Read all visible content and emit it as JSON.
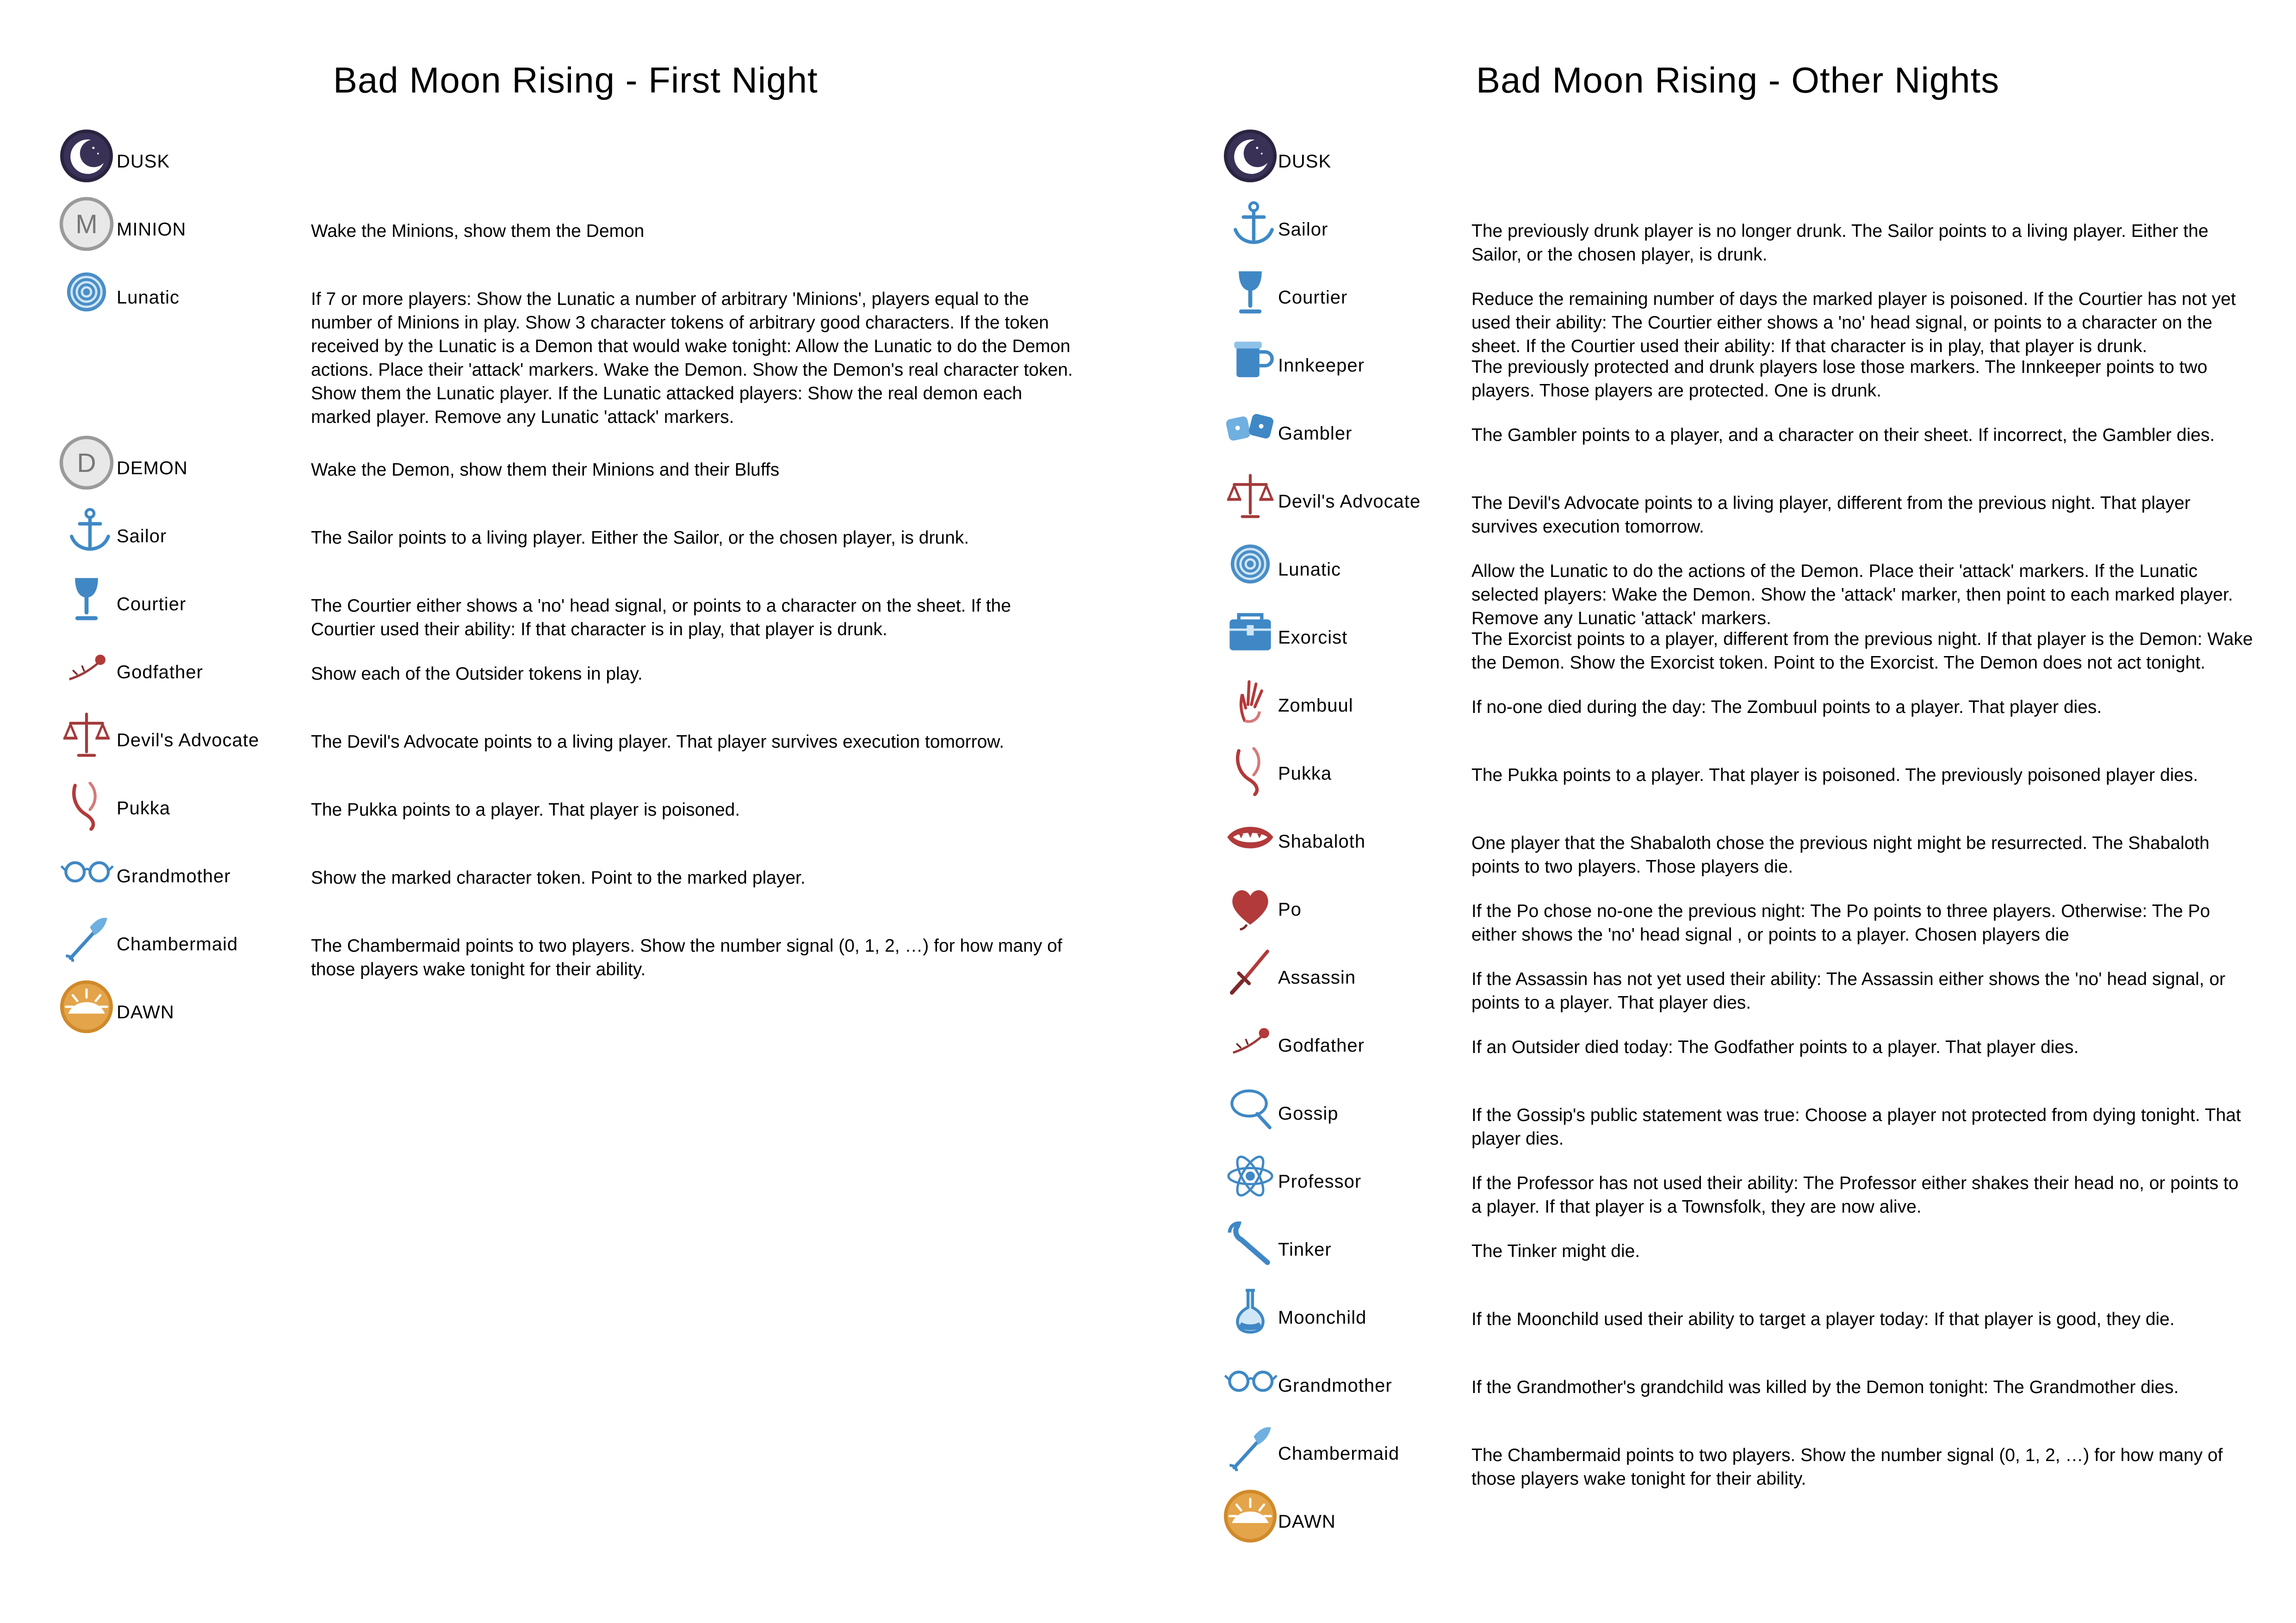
{
  "first_night": {
    "title": "Bad Moon Rising - First Night",
    "entries": [
      {
        "icon": "moon-icon",
        "name": "DUSK",
        "text": ""
      },
      {
        "icon": "minion-token-icon",
        "name": "MINION",
        "text": "Wake the Minions, show them the Demon"
      },
      {
        "icon": "spiral-icon",
        "name": "Lunatic",
        "text": "If 7 or more players: Show the Lunatic a number of arbitrary 'Minions', players equal to the number of Minions in play. Show 3 character tokens of arbitrary good characters. If the token received by the Lunatic is a Demon that would wake tonight: Allow the Lunatic to do the Demon actions. Place their 'attack' markers. Wake the Demon. Show the Demon's real character token. Show them the Lunatic player. If the Lunatic attacked players: Show the real demon each marked player. Remove any Lunatic 'attack' markers."
      },
      {
        "icon": "demon-token-icon",
        "name": "DEMON",
        "text": "Wake the Demon, show them their Minions and their Bluffs"
      },
      {
        "icon": "anchor-icon",
        "name": "Sailor",
        "text": "The Sailor points to a living player. Either the Sailor, or the chosen player, is drunk."
      },
      {
        "icon": "goblet-icon",
        "name": "Courtier",
        "text": "The Courtier either shows a 'no' head signal, or points to a character on the sheet. If the Courtier used their ability: If that character is in play, that player is drunk."
      },
      {
        "icon": "rose-icon",
        "name": "Godfather",
        "text": "Show each of the Outsider tokens in play."
      },
      {
        "icon": "scales-icon",
        "name": "Devil's Advocate",
        "text": "The Devil's Advocate points to a living player. That player survives execution tomorrow."
      },
      {
        "icon": "bone-icon",
        "name": "Pukka",
        "text": "The Pukka points to a player. That player is poisoned."
      },
      {
        "icon": "glasses-icon",
        "name": "Grandmother",
        "text": "Show the marked character token. Point to the marked player."
      },
      {
        "icon": "feather-duster-icon",
        "name": "Chambermaid",
        "text": "The Chambermaid points to two players. Show the number signal (0, 1, 2, …) for how many of those players wake tonight for their ability."
      },
      {
        "icon": "sun-icon",
        "name": "DAWN",
        "text": ""
      }
    ]
  },
  "other_nights": {
    "title": "Bad Moon Rising - Other Nights",
    "entries": [
      {
        "icon": "moon-icon",
        "name": "DUSK",
        "text": ""
      },
      {
        "icon": "anchor-icon",
        "name": "Sailor",
        "text": "The previously drunk player is no longer drunk. The Sailor points to a living player. Either the Sailor, or the chosen player, is drunk."
      },
      {
        "icon": "goblet-icon",
        "name": "Courtier",
        "text": "Reduce the remaining number of days the marked player is poisoned. If the Courtier has not yet used their ability: The Courtier either shows a 'no' head signal, or points to a character on the sheet. If the Courtier used their ability: If that character is in play, that player is drunk."
      },
      {
        "icon": "tankard-icon",
        "name": "Innkeeper",
        "text": "The previously protected and drunk players lose those markers. The Innkeeper points to two players. Those players are protected. One is drunk."
      },
      {
        "icon": "dice-icon",
        "name": "Gambler",
        "text": "The Gambler points to a player, and a character on their sheet. If incorrect, the Gambler dies."
      },
      {
        "icon": "scales-icon",
        "name": "Devil's Advocate",
        "text": "The Devil's Advocate points to a living player, different from the previous night. That player survives execution tomorrow."
      },
      {
        "icon": "spiral-icon",
        "name": "Lunatic",
        "text": "Allow the Lunatic to do the actions of the Demon. Place their 'attack' markers. If the Lunatic selected players: Wake the Demon. Show the 'attack' marker, then point to each marked player. Remove any Lunatic 'attack' markers."
      },
      {
        "icon": "chest-icon",
        "name": "Exorcist",
        "text": "The Exorcist points to a player, different from the previous night. If that player is the Demon: Wake the Demon. Show the Exorcist token. Point to the Exorcist. The Demon does not act tonight."
      },
      {
        "icon": "hand-icon",
        "name": "Zombuul",
        "text": "If no-one died during the day: The Zombuul points to a player. That player dies."
      },
      {
        "icon": "bone-icon",
        "name": "Pukka",
        "text": "The Pukka points to a player. That player is poisoned. The previously poisoned player dies."
      },
      {
        "icon": "mouth-icon",
        "name": "Shabaloth",
        "text": "One player that the Shabaloth chose the previous night might be resurrected. The Shabaloth points to two players. Those players die."
      },
      {
        "icon": "heart-icon",
        "name": "Po",
        "text": "If the Po chose no-one the previous night: The Po points to three players. Otherwise: The Po either shows the 'no' head signal , or points to a player. Chosen players die"
      },
      {
        "icon": "dagger-icon",
        "name": "Assassin",
        "text": "If the Assassin has not yet used their ability: The Assassin either shows the 'no' head signal, or points to a player. That player dies."
      },
      {
        "icon": "rose-icon",
        "name": "Godfather",
        "text": "If an Outsider died today: The Godfather points to a player. That player dies."
      },
      {
        "icon": "speech-icon",
        "name": "Gossip",
        "text": "If the Gossip's public statement was true: Choose a player not protected from dying tonight. That player dies."
      },
      {
        "icon": "atom-icon",
        "name": "Professor",
        "text": "If the Professor has not used their ability: The Professor either shakes their head no, or points to a player. If that player is a Townsfolk, they are now alive."
      },
      {
        "icon": "wrench-icon",
        "name": "Tinker",
        "text": "The Tinker might die."
      },
      {
        "icon": "flask-icon",
        "name": "Moonchild",
        "text": "If the Moonchild used their ability to target a player today: If that player is good, they die."
      },
      {
        "icon": "glasses-icon",
        "name": "Grandmother",
        "text": "If the Grandmother's grandchild was killed by the Demon tonight: The Grandmother dies."
      },
      {
        "icon": "feather-duster-icon",
        "name": "Chambermaid",
        "text": "The Chambermaid points to two players. Show the number signal (0, 1, 2, …) for how many of those players wake tonight for their ability."
      },
      {
        "icon": "sun-icon",
        "name": "DAWN",
        "text": ""
      }
    ]
  }
}
